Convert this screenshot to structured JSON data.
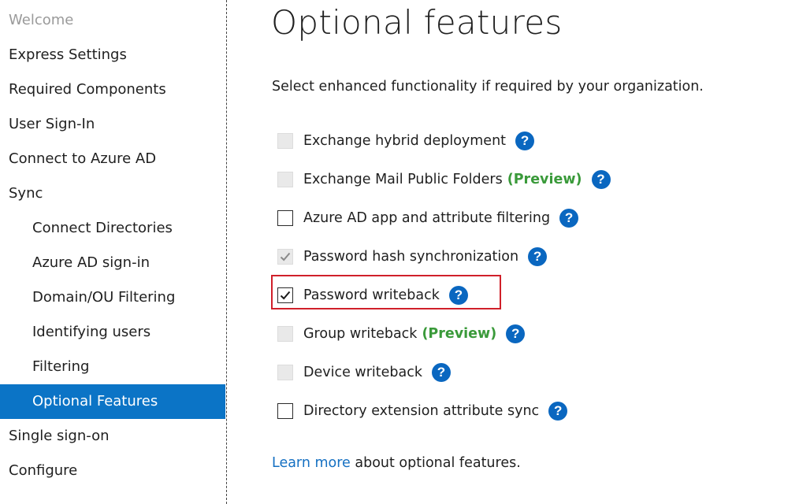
{
  "sidebar": {
    "items": [
      {
        "label": "Welcome",
        "level": 0,
        "state": "disabled"
      },
      {
        "label": "Express Settings",
        "level": 0,
        "state": "normal"
      },
      {
        "label": "Required Components",
        "level": 0,
        "state": "normal"
      },
      {
        "label": "User Sign-In",
        "level": 0,
        "state": "normal"
      },
      {
        "label": "Connect to Azure AD",
        "level": 0,
        "state": "normal"
      },
      {
        "label": "Sync",
        "level": 0,
        "state": "normal"
      },
      {
        "label": "Connect Directories",
        "level": 1,
        "state": "normal"
      },
      {
        "label": "Azure AD sign-in",
        "level": 1,
        "state": "normal"
      },
      {
        "label": "Domain/OU Filtering",
        "level": 1,
        "state": "normal"
      },
      {
        "label": "Identifying users",
        "level": 1,
        "state": "normal"
      },
      {
        "label": "Filtering",
        "level": 1,
        "state": "normal"
      },
      {
        "label": "Optional Features",
        "level": 1,
        "state": "selected"
      },
      {
        "label": "Single sign-on",
        "level": 0,
        "state": "normal"
      },
      {
        "label": "Configure",
        "level": 0,
        "state": "normal"
      }
    ]
  },
  "page": {
    "title": "Optional features",
    "subtitle": "Select enhanced functionality if required by your organization."
  },
  "features": [
    {
      "label": "Exchange hybrid deployment",
      "preview": "",
      "enabled": false,
      "checked": false
    },
    {
      "label": "Exchange Mail Public Folders",
      "preview": "(Preview)",
      "enabled": false,
      "checked": false
    },
    {
      "label": "Azure AD app and attribute filtering",
      "preview": "",
      "enabled": true,
      "checked": false
    },
    {
      "label": "Password hash synchronization",
      "preview": "",
      "enabled": false,
      "checked": true
    },
    {
      "label": "Password writeback",
      "preview": "",
      "enabled": true,
      "checked": true
    },
    {
      "label": "Group writeback",
      "preview": "(Preview)",
      "enabled": false,
      "checked": false
    },
    {
      "label": "Device writeback",
      "preview": "",
      "enabled": false,
      "checked": false
    },
    {
      "label": "Directory extension attribute sync",
      "preview": "",
      "enabled": true,
      "checked": false
    }
  ],
  "help_icon": {
    "name": "help-icon",
    "glyph": "?"
  },
  "footer": {
    "link_text": "Learn more",
    "rest_text": " about optional features."
  },
  "colors": {
    "selected_bg": "#0b74c6",
    "preview_green": "#3a9a3a",
    "help_blue": "#0a67c0",
    "highlight_red": "#d0202a",
    "link_blue": "#1570c2"
  }
}
